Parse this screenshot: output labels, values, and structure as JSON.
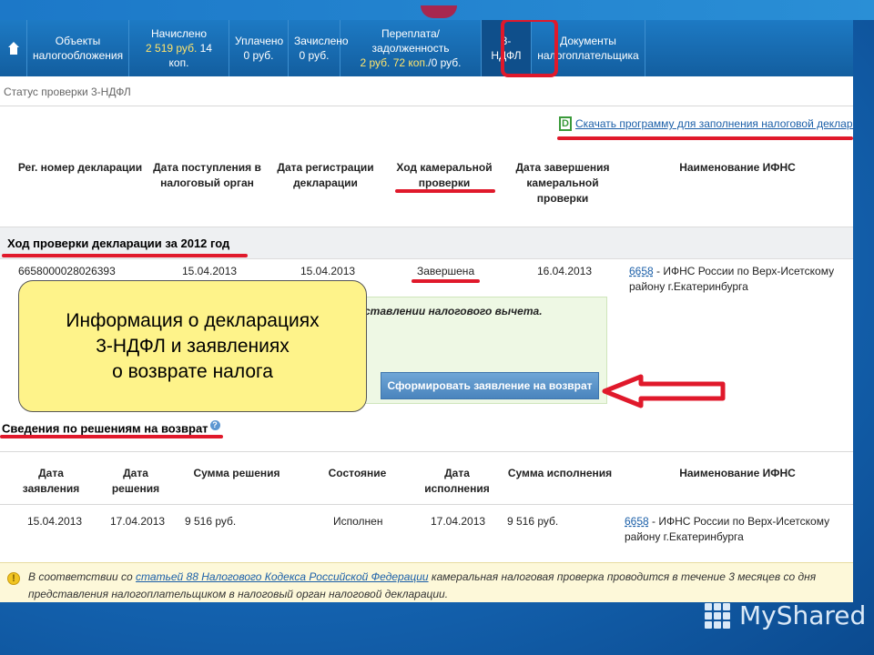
{
  "nav": {
    "home_icon": "home-icon",
    "items": [
      {
        "line1": "Объекты",
        "line2": "налогообложения"
      },
      {
        "line1": "Начислено",
        "line2a": "2 519 руб.",
        "line2b": " 14 коп."
      },
      {
        "line1": "Уплачено",
        "line2": "0 руб."
      },
      {
        "line1": "Зачислено",
        "line2": "0 руб."
      },
      {
        "line1": "Переплата/задолженность",
        "line2a": "2 руб. 72 коп.",
        "line2b": "/0 руб."
      },
      {
        "line1": "3-НДФЛ"
      },
      {
        "line1": "Документы",
        "line2": "налогоплательщика"
      }
    ],
    "colors": {
      "bar": "#135e9f",
      "highlight": "#ffe46b",
      "annotation": "#e0192b"
    }
  },
  "status_title": "Статус проверки 3-НДФЛ",
  "download_link": "Скачать программу для заполнения налоговой деклара",
  "decl_table": {
    "headers": [
      "Рег. номер декларации",
      "Дата поступления в налоговый орган",
      "Дата регистрации декларации",
      "Ход камеральной проверки",
      "Дата завершения камеральной проверки",
      "Наименование ИФНС"
    ],
    "section_title": "Ход проверки декларации за 2012 год",
    "row": {
      "reg_number": "6658000028026393",
      "received": "15.04.2013",
      "registered": "15.04.2013",
      "status": "Завершена",
      "completed": "16.04.2013",
      "ifns_code": "6658",
      "ifns_name_1": " - ИФНС России по Верх-Исетскому",
      "ifns_name_2": "району г.Екатеринбурга"
    }
  },
  "deduction_box": {
    "text": "ставлении налогового вычета.",
    "button": "Сформировать заявление на возврат"
  },
  "callout": {
    "line1": "Информация о декларациях",
    "line2": "3-НДФЛ и заявлениях",
    "line3": "о возврате налога"
  },
  "refund_section": {
    "title": "Сведения по решениям на возврат",
    "help": "?",
    "headers": [
      "Дата заявления",
      "Дата решения",
      "Сумма решения",
      "Состояние",
      "Дата исполнения",
      "Сумма исполнения",
      "Наименование ИФНС"
    ],
    "row": {
      "applied": "15.04.2013",
      "decided": "17.04.2013",
      "amount": "9 516 руб.",
      "state": "Исполнен",
      "executed": "17.04.2013",
      "exec_amount": "9 516 руб.",
      "ifns_code": "6658",
      "ifns_name_1": " - ИФНС России по Верх-Исетскому",
      "ifns_name_2": "району г.Екатеринбурга"
    }
  },
  "note": {
    "icon": "!",
    "pre": "В соответствии со ",
    "link": "статьей 88 Налогового Кодекса Российской Федерации",
    "post": " камеральная налоговая проверка проводится в течение 3 месяцев со дня",
    "line2": "представления налогоплательщиком в налоговый орган налоговой декларации."
  },
  "brand": "MyShared"
}
